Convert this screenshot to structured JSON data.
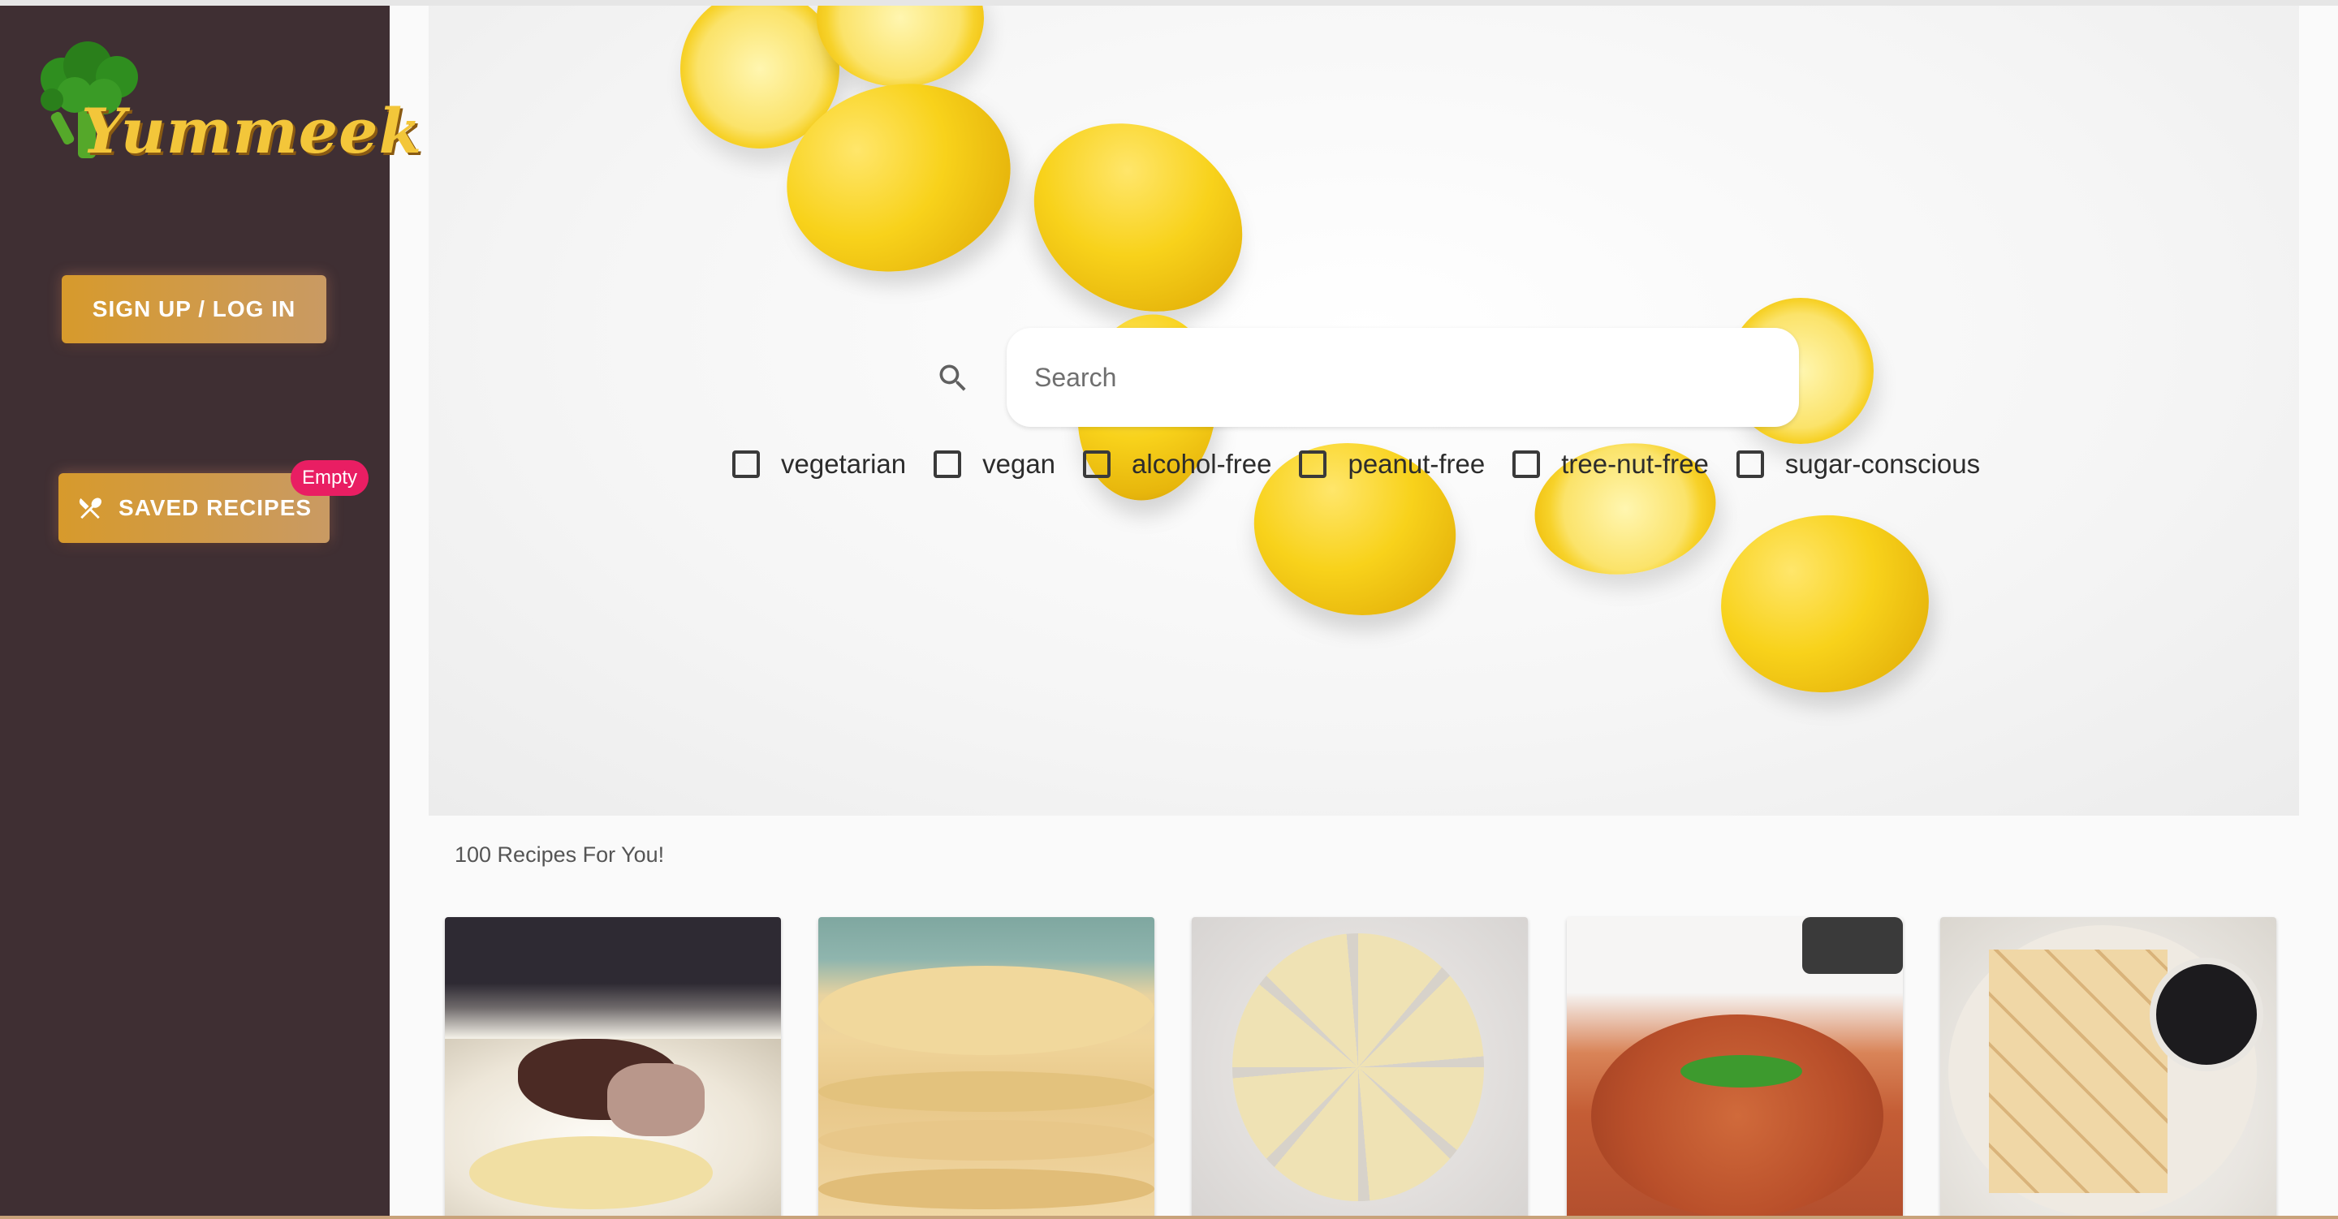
{
  "app": {
    "brand_name": "Yummeek"
  },
  "sidebar": {
    "login_label": "SIGN UP / LOG IN",
    "saved_label": "SAVED RECIPES",
    "saved_badge": "Empty",
    "saved_icon": "fork-knife-icon",
    "colors": {
      "background": "#3f2f33",
      "button_gold": "#d79a2c",
      "badge_pink": "#e91e63"
    }
  },
  "search": {
    "placeholder": "Search",
    "icon": "search-icon",
    "value": ""
  },
  "filters": [
    {
      "label": "vegetarian",
      "checked": false
    },
    {
      "label": "vegan",
      "checked": false
    },
    {
      "label": "alcohol-free",
      "checked": false
    },
    {
      "label": "peanut-free",
      "checked": false
    },
    {
      "label": "tree-nut-free",
      "checked": false
    },
    {
      "label": "sugar-conscious",
      "checked": false
    }
  ],
  "results": {
    "count_text": "100 Recipes For You!"
  }
}
